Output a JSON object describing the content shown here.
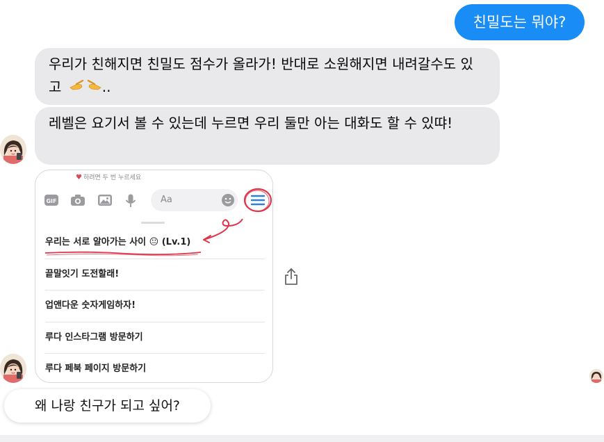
{
  "messages": {
    "user_question": "친밀도는 뭐야?",
    "bot_reply_1": "우리가 친해지면 친밀도 점수가 올라가! 반대로 소원해지면 내려갈수도 있고",
    "bot_reply_1_suffix": "..",
    "bot_reply_2": "레벨은 요기서 볼 수 있는데 누르면 우리 둘만 아는 대화도 할 수 있땨!",
    "bot_suggestion": "왜 나랑 친구가 되고 싶어?"
  },
  "card": {
    "hint": "하려면 두 번 누르세요",
    "input_placeholder": "Aa",
    "toolbar_icons": [
      "gif-icon",
      "camera-icon",
      "image-icon",
      "microphone-icon",
      "emoji-icon",
      "menu-icon"
    ],
    "menu_items": [
      {
        "label": "우리는 서로 알아가는 사이 😐 (Lv.1)"
      },
      {
        "label": "끝말잇기 도전할래!"
      },
      {
        "label": "업앤다운 숫자게임하자!"
      },
      {
        "label": "루다 인스타그램 방문하기"
      },
      {
        "label": "루다 페북 페이지 방문하기"
      }
    ]
  },
  "colors": {
    "user_bubble": "#1a8cf5",
    "bot_bubble": "#e9e9ec",
    "annotation": "#e0344a"
  }
}
